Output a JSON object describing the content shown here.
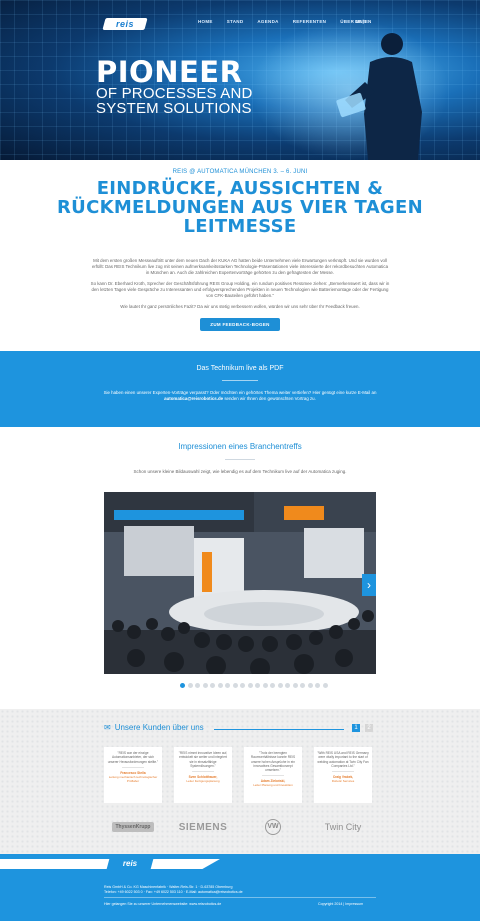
{
  "header": {
    "logo": "reis",
    "nav": [
      "HOME",
      "STAND",
      "AGENDA",
      "REFERENTEN",
      "ÜBER UNS"
    ],
    "lang": "DE | EN"
  },
  "hero": {
    "title": "PIONEER",
    "line1": "OF PROCESSES AND",
    "line2": "SYSTEM SOLUTIONS"
  },
  "intro": {
    "eyebrow": "REIS @ AUTOMATICA MÜNCHEN 3. – 6. JUNI",
    "headline_1": "EINDRÜCKE, AUSSICHTEN &",
    "headline_2": "RÜCKMELDUNGEN AUS VIER TAGEN",
    "headline_3": "LEITMESSE",
    "p1": "Mit dem ersten großen Messeauftritt unter dem neuen Dach der KUKA AG hatten beide Unternehmen viele Erwartungen verknüpft. Und sie wurden voll erfüllt: Das REIS Technikum live zog mit seinen aufmerksamkeitsstarken Technologie-Präsentationen viele interessierte der rekordbesuchten Automatica in München an. Auch die zahlreichen Expertenvorträge gehörten zu den gefragtesten der Messe.",
    "p2": "So kann Dr. Eberhard Kroth, Sprecher der Geschäftsführung REIS Group Holding, ein rundum positives Resümee ziehen: „Bemerkenswert ist, dass wir in den letzten Tagen viele Gespräche zu Interessanten und erfolgversprechenden Projekten in neuen Technologien wie Batteriemontage oder der Fertigung von CFK-Bauteilen geführt haben.“",
    "p3": "Wie lautet Ihr ganz persönliches Fazit? Da wir uns stetig verbessern wollen, würden wir uns sehr über Ihr Feedback freuen.",
    "button": "ZUM FEEDBACK-BOGEN"
  },
  "band": {
    "title": "Das Technikum live als PDF",
    "text_pre": "Sie haben einen unserer Experten-Vorträge verpasst? Oder möchten ein gehörtes Thema weiter vertiefen? Hier genügt eine kurze E-Mail an",
    "email": "automatica@reisrobotics.de",
    "text_post": "senden wir Ihnen den gewünschten Vortrag zu."
  },
  "impressions": {
    "title": "Impressionen eines Branchentreffs",
    "text": "Schon unsere kleine Bildauswahl zeigt, wie lebendig es auf dem Technikum live auf der Automatica zuging.",
    "next": "›",
    "slides": 20,
    "active_slide": 1
  },
  "customers": {
    "title": "Unsere Kunden über uns",
    "page_1": "1",
    "page_2": "2",
    "quotes": [
      {
        "text": "\"REIS war der einzige Automationsanbieter, der sich unserer Herausforderungen stellte.\"",
        "name": "Francesco Stella",
        "role": "Leitung mechanisch technologischer Prüflabor"
      },
      {
        "text": "\"REIS nimmt innovative Ideen auf, entwickelt sie weiter und integriert sie in einsatzfähige Systemlösungen.\"",
        "name": "Sven Schlotthauer,",
        "role": "Leiter Fertigungsplanung"
      },
      {
        "text": "\"Trotz der beengten Raumverhältnisse konnte REIS unsere hohen Ansprüche in ein innovatives Gesamtkonzept umsetzen.\"",
        "name": "Adam Zieloński,",
        "role": "Leiter Planung und Investition"
      },
      {
        "text": "\"With REIS USA and REIS Germany were vitally important to the start of welding automation at Twin City Fan Companies Ltd.\"",
        "name": "Craig Vrabek,",
        "role": "Robotic Services"
      }
    ],
    "logos": [
      "ThyssenKrupp",
      "SIEMENS",
      "VW",
      "Twin City"
    ]
  },
  "footer": {
    "logo": "reis",
    "line1": "Reis GmbH & Co. KG Maschinenfabrik · Walter-Reis-Str. 1 · D-63785 Obernburg",
    "line2": "Telefon: +49 6022 503 0 · Fax: +49 6022 503 110 · E-Mail: automatica@reisrobotics.de",
    "line3": "Hier gelangen Sie zu unserer Unternehmenswebsite: www.reisrobotics.de",
    "copyright": "Copyright 2014 | Impressum"
  }
}
